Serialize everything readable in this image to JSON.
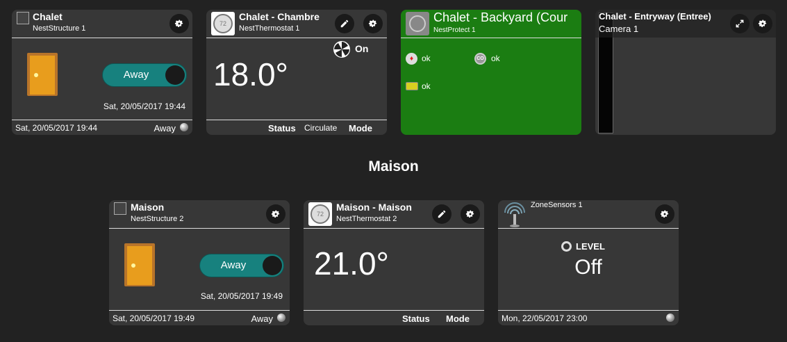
{
  "section_title": "Maison",
  "chalet_structure": {
    "name": "Chalet",
    "subtitle": "NestStructure 1",
    "toggle_label": "Away",
    "timestamp": "Sat, 20/05/2017 19:44",
    "footer_left": "Sat, 20/05/2017 19:44",
    "footer_right": "Away"
  },
  "chalet_thermostat": {
    "name": "Chalet - Chambre",
    "subtitle": "NestThermostat 1",
    "icon_text": "72",
    "fan_label": "On",
    "temperature": "18.0°",
    "footer_status": "Status",
    "footer_status_value": "Circulate",
    "footer_mode": "Mode"
  },
  "chalet_protect": {
    "name": "Chalet - Backyard (Cour",
    "subtitle": "NestProtect 1",
    "smoke_status": "ok",
    "co_icon_text": "CO",
    "co_status": "ok",
    "battery_status": "ok",
    "bg_color": "#1b7d12"
  },
  "chalet_camera": {
    "name": "Chalet - Entryway (Entree)",
    "subtitle": "Camera 1"
  },
  "maison_structure": {
    "name": "Maison",
    "subtitle": "NestStructure 2",
    "toggle_label": "Away",
    "timestamp": "Sat, 20/05/2017 19:49",
    "footer_left": "Sat, 20/05/2017 19:49",
    "footer_right": "Away"
  },
  "maison_thermostat": {
    "name": "Maison - Maison",
    "subtitle": "NestThermostat 2",
    "icon_text": "72",
    "temperature": "21.0°",
    "footer_status": "Status",
    "footer_mode": "Mode"
  },
  "zone_sensors": {
    "subtitle": "ZoneSensors 1",
    "level_label": "LEVEL",
    "level_value": "Off",
    "footer_left": "Mon, 22/05/2017 23:00"
  },
  "colors": {
    "background": "#222222",
    "tile": "#373737",
    "accent_toggle": "#17817e",
    "protect_green": "#1b7d12"
  }
}
